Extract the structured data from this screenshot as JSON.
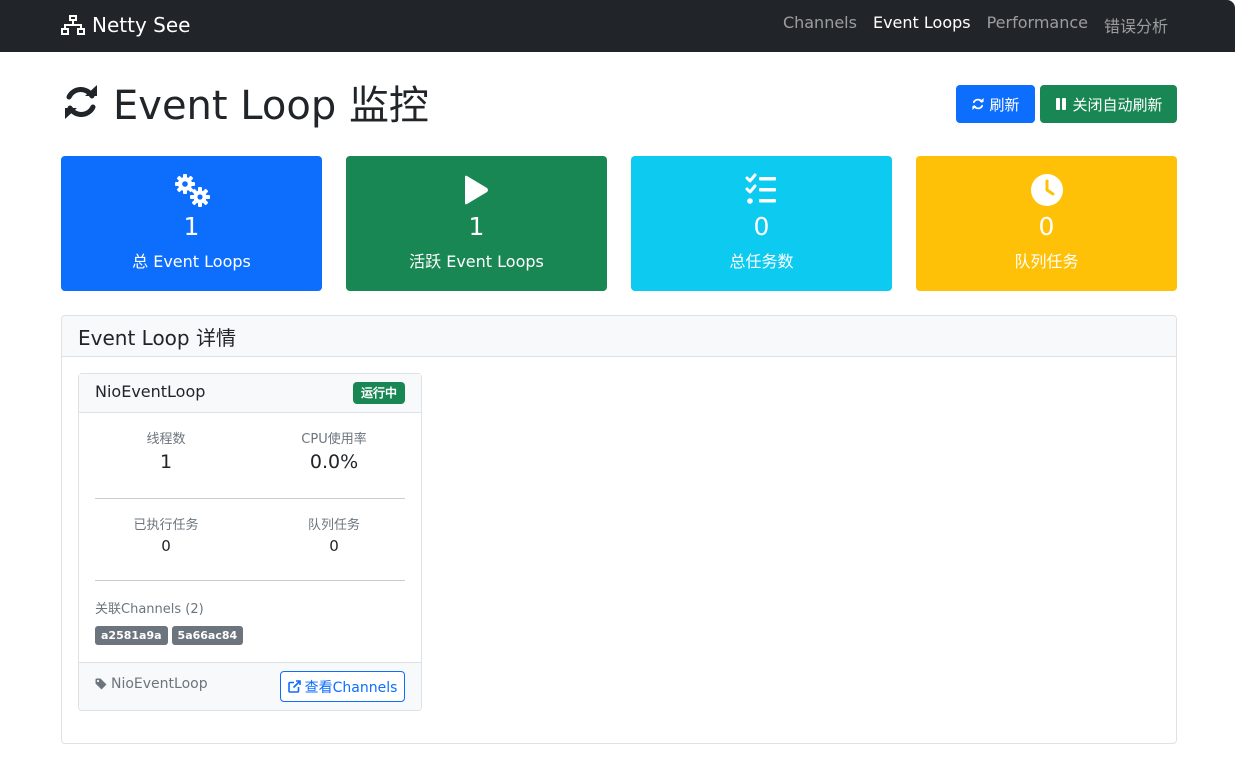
{
  "nav": {
    "brand": "Netty See",
    "links": [
      {
        "label": "Channels",
        "active": false
      },
      {
        "label": "Event Loops",
        "active": true
      },
      {
        "label": "Performance",
        "active": false
      },
      {
        "label": "错误分析",
        "active": false
      }
    ]
  },
  "page": {
    "title": "Event Loop 监控",
    "refresh_button": "刷新",
    "auto_refresh_button": "关闭自动刷新"
  },
  "stats": [
    {
      "value": "1",
      "label": "总 Event Loops",
      "icon": "gears-icon",
      "color": "#0d6efd"
    },
    {
      "value": "1",
      "label": "活跃 Event Loops",
      "icon": "play-icon",
      "color": "#198754"
    },
    {
      "value": "0",
      "label": "总任务数",
      "icon": "task-list-icon",
      "color": "#0dcaf0"
    },
    {
      "value": "0",
      "label": "队列任务",
      "icon": "clock-icon",
      "color": "#ffc107"
    }
  ],
  "details": {
    "header": "Event Loop 详情",
    "event_loops": [
      {
        "name": "NioEventLoop",
        "status": "运行中",
        "thread_count_label": "线程数",
        "thread_count": "1",
        "cpu_label": "CPU使用率",
        "cpu": "0.0%",
        "executed_label": "已执行任务",
        "executed": "0",
        "queued_label": "队列任务",
        "queued": "0",
        "channels_label": "关联Channels (2)",
        "channels": [
          "a2581a9a",
          "5a66ac84"
        ],
        "tag": "NioEventLoop",
        "view_button": "查看Channels"
      }
    ]
  }
}
